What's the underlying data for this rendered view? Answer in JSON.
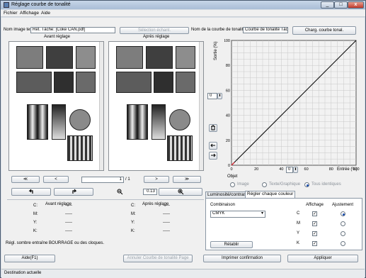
{
  "window": {
    "title": "Réglage courbe de tonalité",
    "controls": [
      "_",
      "□",
      "x"
    ]
  },
  "menu": {
    "file": "Fichier",
    "view": "Affichage",
    "help": "Aide"
  },
  "top": {
    "image_name_label": "Nom image test",
    "image_name_value": "Ret. Tâche: [Coke CAN.pdf]",
    "select_sample_button": "Sélection échant.",
    "curve_name_label": "Nom de la courbe de tonalité",
    "curve_name_value": "Courbe de tonalité Tâche",
    "load_curve_button": "Charg. courbe tonal."
  },
  "preview": {
    "before_title": "Avant réglage",
    "after_title": "Après réglage",
    "first_button": "≪",
    "prev_button": "<",
    "page_value": "1",
    "page_total": "/ 1",
    "next_button": ">",
    "last_button": "≫",
    "zoom_value": "0.13"
  },
  "graph": {
    "y_title": "Sortie (%)",
    "x_title": "Entrée (%)",
    "y_ticks": [
      "100",
      "80",
      "60",
      "40",
      "20",
      "0"
    ],
    "x_ticks": [
      "0",
      "20",
      "40",
      "60",
      "80",
      "100"
    ],
    "output_value": "0",
    "input_value": "0"
  },
  "objet": {
    "title": "Objet",
    "options": [
      "Image",
      "Texte/Graphique",
      "Tous identiques"
    ],
    "selected": "Tous identiques"
  },
  "adjust_panel": {
    "tabs": [
      "Luminosité/contraste",
      "Régler chaque couleur"
    ],
    "active_tab": "Régler chaque couleur",
    "combination_label": "Combinaison",
    "display_label": "Affichage",
    "adjust_label": "Ajustement",
    "combination_value": "CMYK",
    "channels": [
      "C",
      "M",
      "Y",
      "K"
    ],
    "reset_button": "Rétablir"
  },
  "density": {
    "before_title": "Avant réglage",
    "after_title": "Après réglage",
    "rows": [
      {
        "label": "C:",
        "before": "-----",
        "after": "-----"
      },
      {
        "label": "M:",
        "before": "-----",
        "after": "-----"
      },
      {
        "label": "Y:",
        "before": "-----",
        "after": "-----"
      },
      {
        "label": "K:",
        "before": "-----",
        "after": "-----"
      }
    ],
    "note": "Régl. sombre entraîne BOURRAGE ou des cloques."
  },
  "bottom": {
    "help_button": "Aide(F1)",
    "cancel_button": "Annuler Courbe de tonalité Page",
    "print_button": "Imprimer confirmation",
    "apply_button": "Appliquer"
  },
  "status": {
    "text": "Destination actuelle"
  },
  "colors": {
    "accent": "#1b4fb0",
    "curve": "#000000",
    "grid": "#c8c8c8",
    "curve_origin": "#d9303a"
  }
}
